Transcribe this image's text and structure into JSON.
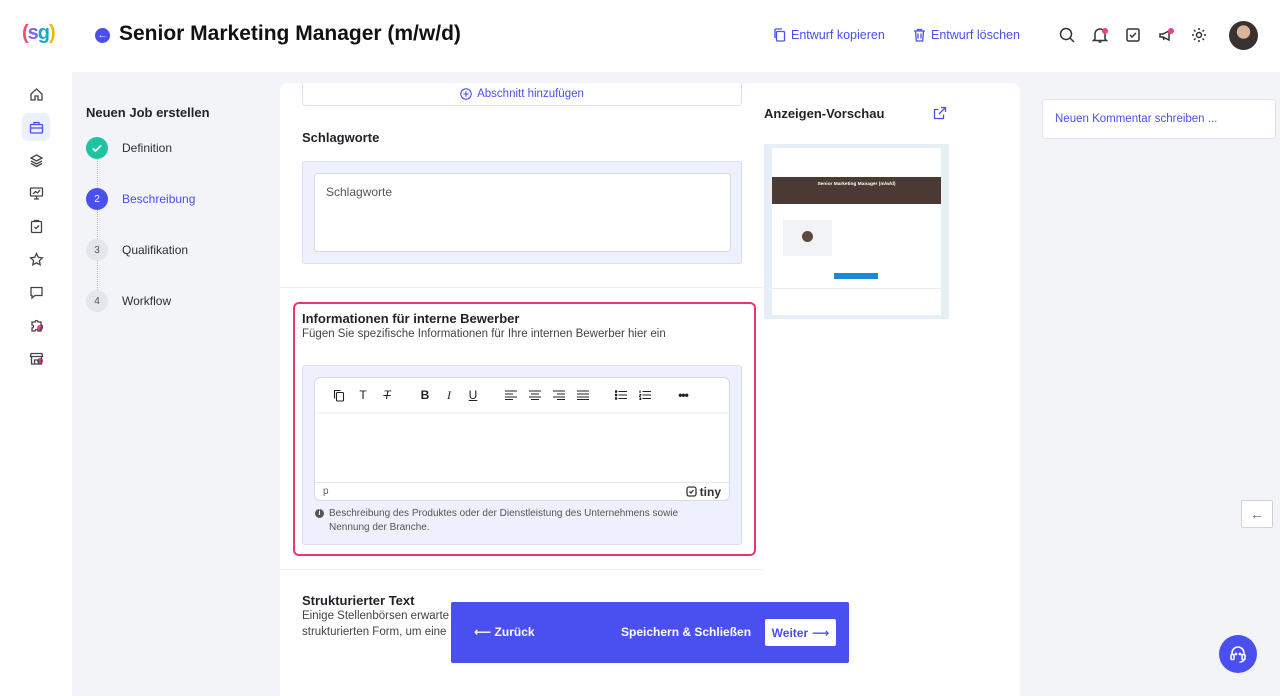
{
  "header": {
    "logo_parts": [
      "(",
      "s",
      "g",
      ")"
    ],
    "title": "Senior Marketing Manager (m/w/d)",
    "copy_draft": "Entwurf kopieren",
    "delete_draft": "Entwurf löschen"
  },
  "stepper": {
    "title": "Neuen Job erstellen",
    "steps": [
      {
        "num": "1",
        "label": "Definition"
      },
      {
        "num": "2",
        "label": "Beschreibung"
      },
      {
        "num": "3",
        "label": "Qualifikation"
      },
      {
        "num": "4",
        "label": "Workflow"
      }
    ]
  },
  "main": {
    "add_section": "Abschnitt hinzufügen",
    "keywords_title": "Schlagworte",
    "keywords_placeholder": "Schlagworte",
    "internal": {
      "title": "Informationen für interne Bewerber",
      "subtitle": "Fügen Sie spezifische Informationen für Ihre internen Bewerber hier ein",
      "status_path": "p",
      "brand": "tiny",
      "hint": "Beschreibung des Produktes oder der Dienstleistung des Unternehmens sowie Nennung der Branche."
    },
    "structured": {
      "title": "Strukturierter Text",
      "line1": "Einige Stellenbörsen erwarte",
      "line2": "strukturierten Form, um eine"
    }
  },
  "preview": {
    "title": "Anzeigen-Vorschau",
    "banner_title": "Senior Marketing Manager (m/w/d)"
  },
  "comment": {
    "placeholder": "Neuen Kommentar schreiben ..."
  },
  "actions": {
    "back": "Zurück",
    "save_close": "Speichern & Schließen",
    "next": "Weiter"
  },
  "colors": {
    "accent": "#4a4ff0",
    "done": "#1fc3a1",
    "highlight": "#e5386d"
  }
}
